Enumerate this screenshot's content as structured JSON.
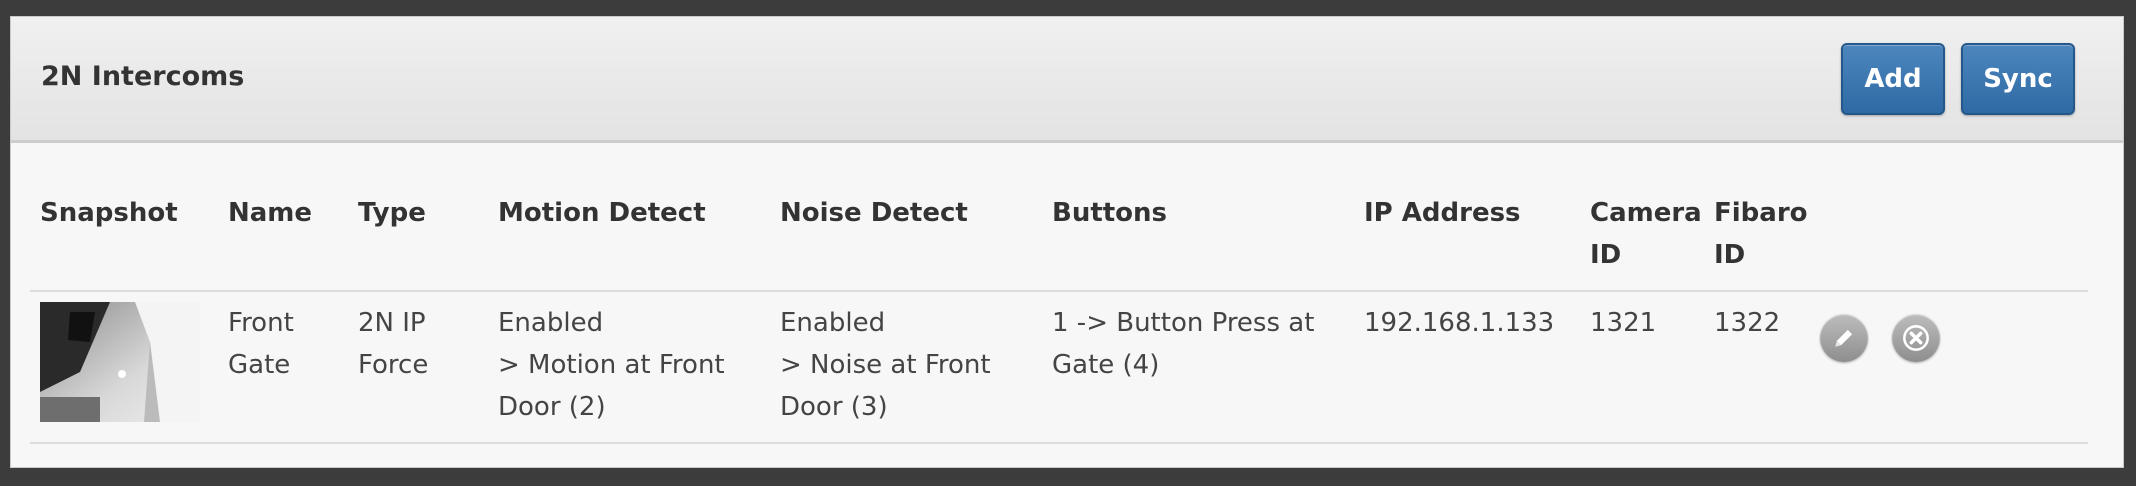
{
  "panel": {
    "title": "2N Intercoms",
    "add_label": "Add",
    "sync_label": "Sync"
  },
  "table": {
    "headers": {
      "snapshot": "Snapshot",
      "name": "Name",
      "type": "Type",
      "motion": "Motion Detect",
      "noise": "Noise Detect",
      "buttons": "Buttons",
      "ip": "IP Address",
      "camera": "Camera\nID",
      "fibaro": "Fibaro\nID"
    },
    "rows": [
      {
        "name": "Front\nGate",
        "type": "2N IP\nForce",
        "motion": "Enabled\n> Motion at Front\nDoor (2)",
        "noise": "Enabled\n> Noise at Front\nDoor (3)",
        "buttons": "1 -> Button Press at\nGate (4)",
        "ip": "192.168.1.133",
        "camera_id": "1321",
        "fibaro_id": "1322"
      }
    ]
  },
  "icons": {
    "edit": "pencil-icon",
    "delete": "close-icon"
  },
  "colors": {
    "primary_button": "#3a73ad",
    "background": "#3c3c3c"
  }
}
